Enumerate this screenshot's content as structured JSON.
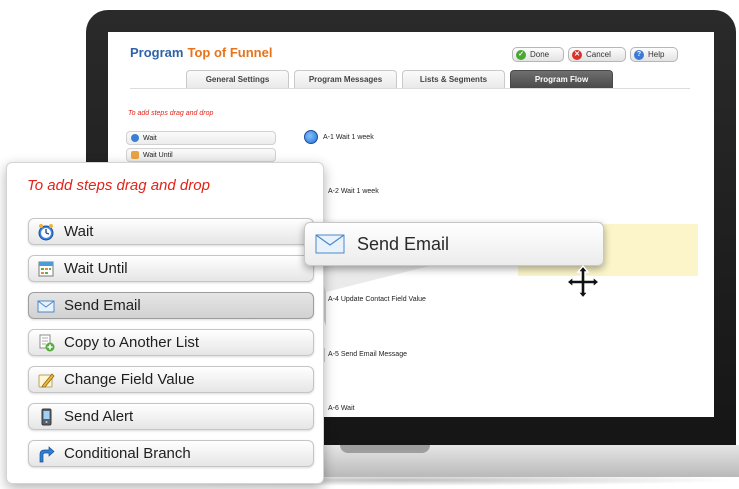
{
  "program": {
    "label": "Program",
    "name": "Top of Funnel",
    "buttons": [
      {
        "label": "Done",
        "icon": "check-icon",
        "color": "#4aa832"
      },
      {
        "label": "Cancel",
        "icon": "x-icon",
        "color": "#d9332a"
      },
      {
        "label": "Help",
        "icon": "question-icon",
        "color": "#3b7ad6"
      }
    ],
    "tabs": [
      {
        "label": "General Settings",
        "active": false
      },
      {
        "label": "Program Messages",
        "active": false
      },
      {
        "label": "Lists & Segments",
        "active": false
      },
      {
        "label": "Program Flow",
        "active": true
      }
    ]
  },
  "screen_palette": {
    "hint": "To add steps drag and drop",
    "items": [
      "Wait",
      "Wait Until"
    ]
  },
  "flow_steps": [
    "A-1 Wait 1 week",
    "A-2 Wait 1 week",
    "A-4 Update Contact Field Value",
    "A-5 Send Email Message",
    "A-6 Wait"
  ],
  "palette": {
    "hint": "To add steps drag and drop",
    "items": [
      {
        "label": "Wait",
        "icon": "clock-icon"
      },
      {
        "label": "Wait Until",
        "icon": "calendar-icon"
      },
      {
        "label": "Send Email",
        "icon": "envelope-icon"
      },
      {
        "label": "Copy to Another List",
        "icon": "copy-list-icon"
      },
      {
        "label": "Change Field Value",
        "icon": "pencil-icon"
      },
      {
        "label": "Send Alert",
        "icon": "phone-alert-icon"
      },
      {
        "label": "Conditional Branch",
        "icon": "branch-arrow-icon"
      }
    ]
  },
  "drag_ghost": {
    "label": "Send Email",
    "icon": "envelope-icon"
  },
  "colors": {
    "accent_blue": "#2e63a8",
    "accent_orange": "#e8731a",
    "hint_red": "#e2231a",
    "highlight": "#fbf5c9"
  }
}
